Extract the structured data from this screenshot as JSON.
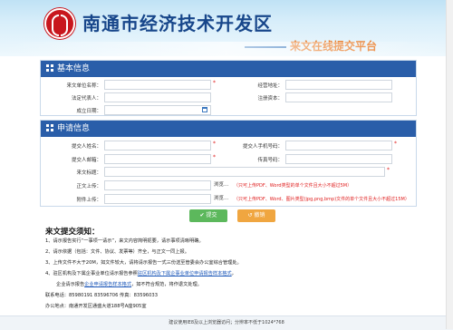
{
  "header": {
    "title": "南通市经济技术开发区",
    "subtitle": "来文在线提交平台"
  },
  "basic_info": {
    "section_title": "基本信息",
    "fields": {
      "company_name_label": "来文单位名称：",
      "address_label": "经营地址：",
      "legal_rep_label": "法定代表人：",
      "capital_label": "注册资本：",
      "established_label": "成立日期："
    }
  },
  "applicant_info": {
    "section_title": "申请信息",
    "fields": {
      "name_label": "提交人姓名：",
      "phone_label": "提交人手机号码：",
      "email_label": "提交人邮箱：",
      "fax_label": "传真号码：",
      "subject_label": "来文标题：",
      "body_label": "正文上传：",
      "attach_label": "附件上传："
    },
    "browse_label": "浏览...",
    "body_hint": "（只可上传PDF、Word类型的单个文件且大小不超过5M）",
    "attach_hint": "（只可上传PDF、Word、图片类型(jpg,png,bmp)文件的单个文件且大小不超过15M）"
  },
  "buttons": {
    "submit": "✔ 提交",
    "cancel": "↺ 撤销"
  },
  "notice": {
    "title": "来文提交须知：",
    "lines": [
      "1、请示报告实行“一事项一请示”，来文内容简明扼要，请示事项清晰明确。",
      "2、请示依据（包括：文件、协议、发票等）齐全，与正文一同上报。",
      "3、上传文件不大于20M，如文件较大，请将请示报告一式三份送至管委会办公室综合管理处。",
      "4、驻区机构及下属企事业单位请示报告参照",
      "企业请示报告",
      "联系电话：85980191 83596706 传真：83596033",
      "办公地点：南通开发区通盛大道188号A座905室"
    ],
    "line4_link": "驻区机构及下属企事业单位申请报告样本格式",
    "line4_tail": "，",
    "line5_link": "企业申请报告样本格式",
    "line5_tail": "，如不符合规范，将作退文处理。"
  },
  "footer": {
    "text": "建议使用IE8及以上浏览器访问；分辨率不低于1024*768"
  }
}
